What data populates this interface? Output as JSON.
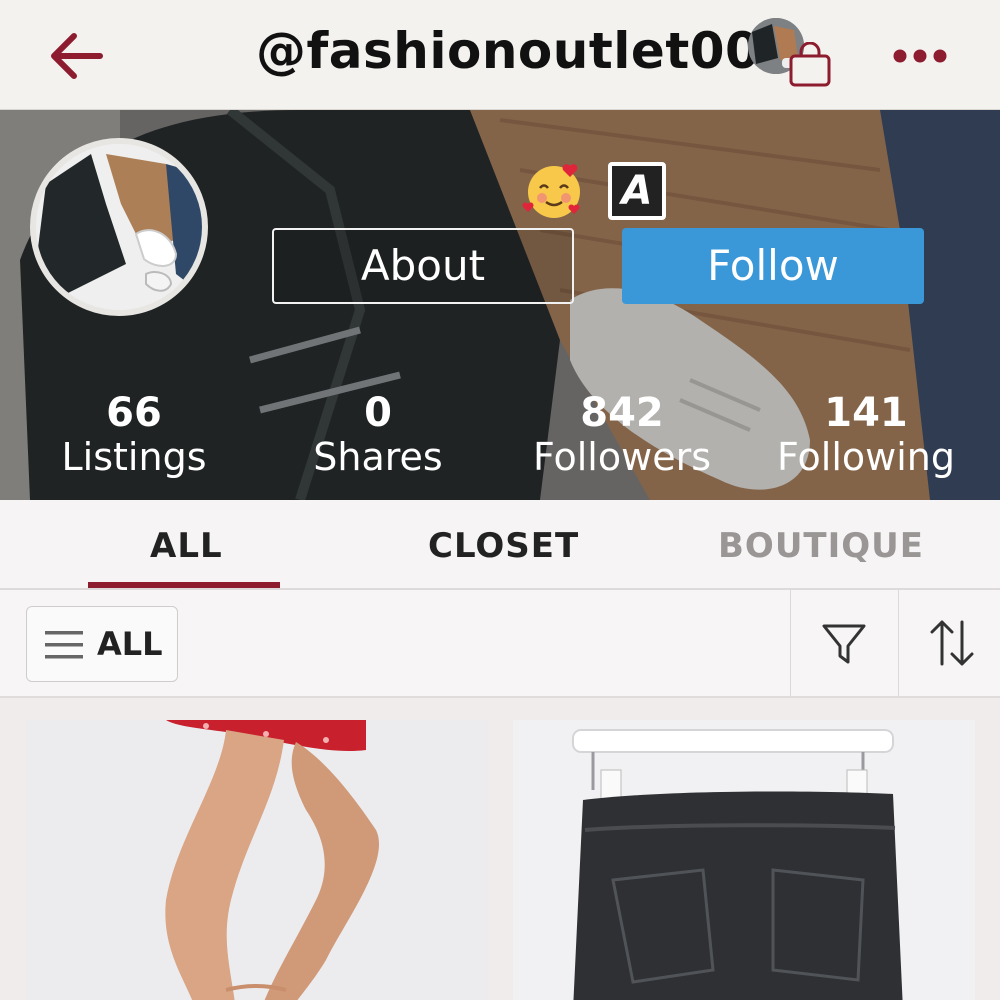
{
  "header": {
    "username": "@fashionoutlet00",
    "back_icon": "back-arrow-icon",
    "more_icon": "more-dots-icon",
    "bag_icon": "shopping-bag-icon"
  },
  "profile": {
    "about_label": "About",
    "follow_label": "Follow",
    "badge_letter": "A",
    "emoji_icon": "smiling-face-with-hearts-icon",
    "stats": [
      {
        "value": "66",
        "label": "Listings"
      },
      {
        "value": "0",
        "label": "Shares"
      },
      {
        "value": "842",
        "label": "Followers"
      },
      {
        "value": "141",
        "label": "Following"
      }
    ]
  },
  "tabs": [
    {
      "label": "ALL",
      "active": true
    },
    {
      "label": "CLOSET",
      "active": false
    },
    {
      "label": "BOUTIQUE",
      "active": false
    }
  ],
  "filterbar": {
    "all_label": "ALL",
    "menu_icon": "hamburger-menu-icon",
    "filter_icon": "filter-funnel-icon",
    "sort_icon": "sort-arrows-icon"
  },
  "colors": {
    "accent": "#8c1c2e",
    "follow_button": "#3a98d8",
    "tab_inactive": "#9a9696"
  }
}
